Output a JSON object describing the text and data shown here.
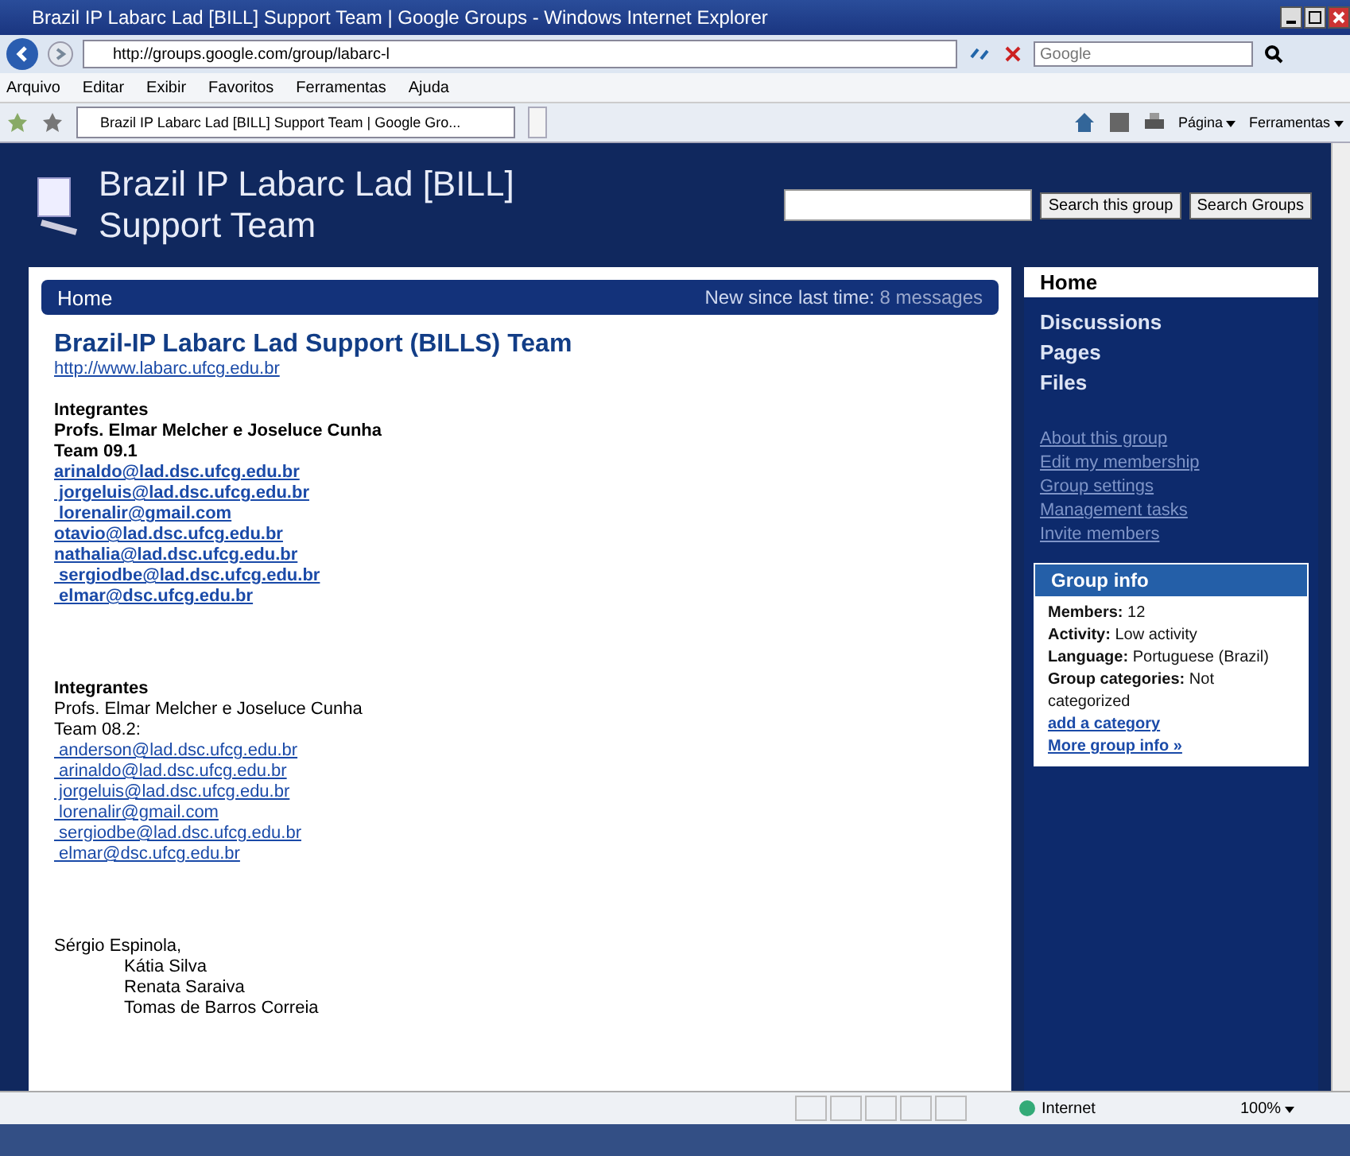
{
  "window": {
    "title": "Brazil IP Labarc Lad [BILL] Support Team | Google Groups - Windows Internet Explorer"
  },
  "address_bar": {
    "url": "http://groups.google.com/group/labarc-l",
    "search_placeholder": "Google"
  },
  "menu": [
    "Arquivo",
    "Editar",
    "Exibir",
    "Favoritos",
    "Ferramentas",
    "Ajuda"
  ],
  "tab": {
    "title": "Brazil IP Labarc Lad [BILL] Support Team | Google Gro..."
  },
  "command_bar": [
    "Página",
    "Ferramentas"
  ],
  "group_header": {
    "title_lines": [
      "Brazil IP Labarc Lad [BILL]",
      "Support Team"
    ],
    "buttons": [
      "Search this group",
      "Search Groups"
    ]
  },
  "home_bar": {
    "label": "Home",
    "new_since": "New since last time:",
    "new_count": "8 messages"
  },
  "content": {
    "heading": "Brazil-IP Labarc Lad Support (BILLS) Team",
    "url": "http://www.labarc.ufcg.edu.br",
    "blocks": [
      {
        "kind": "team",
        "title": "Integrantes",
        "profs": "Profs. Elmar Melcher e Joseluce Cunha",
        "team": "Team 09.1",
        "emails": [
          "arinaldo@lad.dsc.ufcg.edu.br",
          " jorgeluis@lad.dsc.ufcg.edu.br",
          " lorenalir@gmail.com",
          "otavio@lad.dsc.ufcg.edu.br",
          "nathalia@lad.dsc.ufcg.edu.br",
          " sergiodbe@lad.dsc.ufcg.edu.br",
          " elmar@dsc.ufcg.edu.br"
        ]
      },
      {
        "kind": "team",
        "title": "Integrantes",
        "profs": "Profs. Elmar Melcher e Joseluce Cunha",
        "team": "Team 08.2:",
        "emails": [
          " anderson@lad.dsc.ufcg.edu.br",
          " arinaldo@lad.dsc.ufcg.edu.br",
          " jorgeluis@lad.dsc.ufcg.edu.br",
          " lorenalir@gmail.com",
          " sergiodbe@lad.dsc.ufcg.edu.br",
          " elmar@dsc.ufcg.edu.br"
        ]
      },
      {
        "kind": "names",
        "first": "Sérgio Espinola,",
        "rest": [
          "Kátia Silva",
          "Renata Saraiva",
          "Tomas de Barros Correia"
        ]
      }
    ]
  },
  "sidebar": {
    "nav": [
      {
        "label": "Home",
        "selected": true
      },
      {
        "label": "Discussions",
        "selected": false
      },
      {
        "label": "Pages",
        "selected": false
      },
      {
        "label": "Files",
        "selected": false
      }
    ],
    "links": [
      "About this group",
      "Edit my membership",
      "Group settings",
      "Management tasks",
      "Invite members"
    ],
    "group_info": {
      "title": "Group info",
      "lines": [
        "**Members:** 12",
        "**Activity:** Low activity",
        "**Language:** Portuguese (Brazil)",
        "**Group categories:** Not categorized"
      ],
      "links": [
        "add a category",
        "More group info »"
      ]
    }
  },
  "status_bar": {
    "zone": "Internet",
    "zoom": "100%"
  }
}
